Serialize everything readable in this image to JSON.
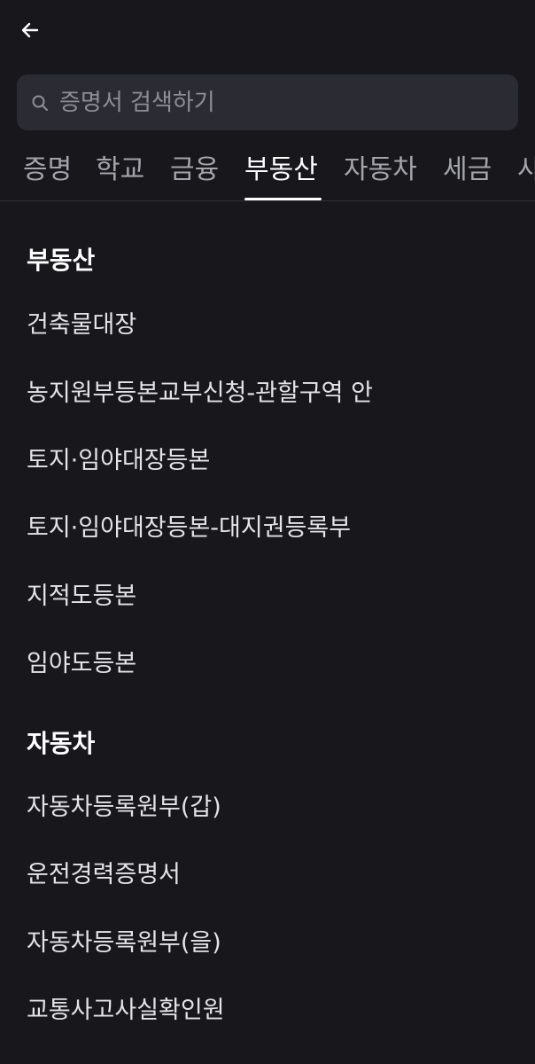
{
  "header": {
    "back_icon": "arrow-left-icon"
  },
  "search": {
    "placeholder": "증명서 검색하기",
    "value": "",
    "icon": "search-icon"
  },
  "tabs": [
    {
      "label": "증명"
    },
    {
      "label": "학교"
    },
    {
      "label": "금융"
    },
    {
      "label": "부동산",
      "active": true
    },
    {
      "label": "자동차"
    },
    {
      "label": "세금"
    },
    {
      "label": "사"
    }
  ],
  "sections": [
    {
      "title": "부동산",
      "items": [
        "건축물대장",
        "농지원부등본교부신청-관할구역 안",
        "토지·임야대장등본",
        "토지·임야대장등본-대지권등록부",
        "지적도등본",
        "임야도등본"
      ]
    },
    {
      "title": "자동차",
      "items": [
        "자동차등록원부(갑)",
        "운전경력증명서",
        "자동차등록원부(을)",
        "교통사고사실확인원"
      ]
    }
  ],
  "colors": {
    "background": "#17171c",
    "search_bg": "#2b2b33",
    "active_tab": "#ffffff",
    "inactive_tab": "#a4a4ac"
  }
}
